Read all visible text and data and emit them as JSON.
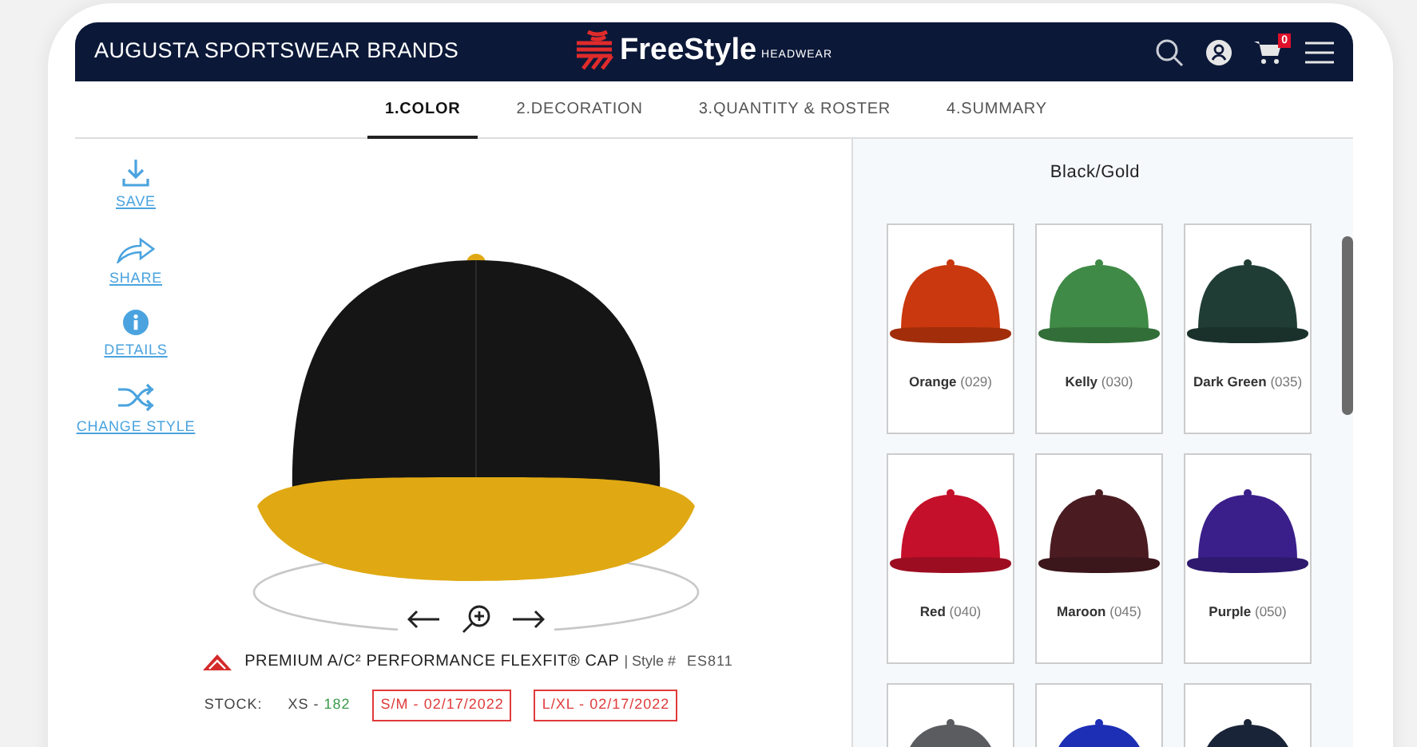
{
  "header": {
    "brand": "AUGUSTA SPORTSWEAR BRANDS",
    "logo_text": "FreeStyle",
    "logo_sub": "HEADWEAR",
    "cart_count": "0"
  },
  "steps": [
    {
      "label": "1.COLOR",
      "selected": true
    },
    {
      "label": "2.DECORATION",
      "selected": false
    },
    {
      "label": "3.QUANTITY & ROSTER",
      "selected": false
    },
    {
      "label": "4.SUMMARY",
      "selected": false
    }
  ],
  "actions": [
    {
      "kind": "save",
      "label": "SAVE"
    },
    {
      "kind": "share",
      "label": "SHARE"
    },
    {
      "kind": "details",
      "label": "DETAILS"
    },
    {
      "kind": "change",
      "label": "CHANGE STYLE"
    }
  ],
  "product": {
    "name": "PREMIUM A/C² PERFORMANCE FLEXFIT® CAP",
    "style_label": "| Style #",
    "style": "ES811",
    "stock_label": "STOCK:",
    "stock": [
      {
        "kind": "available",
        "size": "XS -",
        "value": "182"
      },
      {
        "kind": "dated",
        "size": "S/M -",
        "value": "02/17/2022"
      },
      {
        "kind": "dated",
        "size": "L/XL -",
        "value": "02/17/2022"
      }
    ]
  },
  "colors": {
    "title": "Black/Gold",
    "items": [
      {
        "name": "Orange",
        "code": "(029)",
        "color": "#c9380e"
      },
      {
        "name": "Kelly",
        "code": "(030)",
        "color": "#3f8a46"
      },
      {
        "name": "Dark Green",
        "code": "(035)",
        "color": "#1f3d35"
      },
      {
        "name": "Red",
        "code": "(040)",
        "color": "#c4102a"
      },
      {
        "name": "Maroon",
        "code": "(045)",
        "color": "#4a1c22"
      },
      {
        "name": "Purple",
        "code": "(050)",
        "color": "#3a1f8a"
      },
      {
        "color": "#5a5c60"
      },
      {
        "color": "#1c2fb5"
      },
      {
        "color": "#1a2438"
      }
    ]
  }
}
